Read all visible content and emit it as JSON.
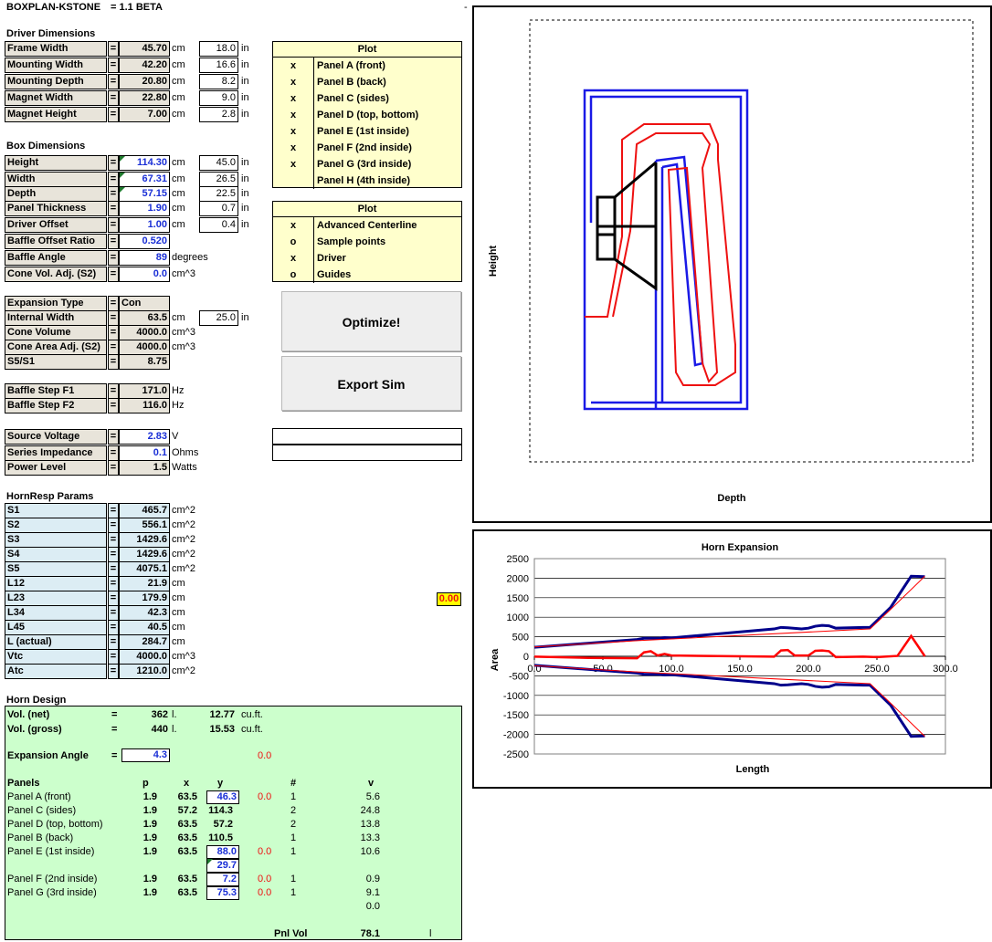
{
  "title": {
    "app": "BOXPLAN-KSTONE",
    "version": "= 1.1 BETA"
  },
  "corner_mark": "-",
  "driver": {
    "heading": "Driver Dimensions",
    "rows": [
      {
        "label": "Frame Width",
        "eq": "=",
        "value": "45.70",
        "unit": "cm",
        "inch": "18.0",
        "iunit": "in"
      },
      {
        "label": "Mounting Width",
        "eq": "=",
        "value": "42.20",
        "unit": "cm",
        "inch": "16.6",
        "iunit": "in"
      },
      {
        "label": "Mounting Depth",
        "eq": "=",
        "value": "20.80",
        "unit": "cm",
        "inch": "8.2",
        "iunit": "in"
      },
      {
        "label": "Magnet Width",
        "eq": "=",
        "value": "22.80",
        "unit": "cm",
        "inch": "9.0",
        "iunit": "in"
      },
      {
        "label": "Magnet Height",
        "eq": "=",
        "value": "7.00",
        "unit": "cm",
        "inch": "2.8",
        "iunit": "in"
      }
    ]
  },
  "box": {
    "heading": "Box Dimensions",
    "rows": [
      {
        "label": "Height",
        "eq": "=",
        "value": "114.30",
        "unit": "cm",
        "inch": "45.0",
        "iunit": "in"
      },
      {
        "label": "Width",
        "eq": "=",
        "value": "67.31",
        "unit": "cm",
        "inch": "26.5",
        "iunit": "in"
      },
      {
        "label": "Depth",
        "eq": "=",
        "value": "57.15",
        "unit": "cm",
        "inch": "22.5",
        "iunit": "in"
      },
      {
        "label": "Panel Thickness",
        "eq": "=",
        "value": "1.90",
        "unit": "cm",
        "inch": "0.7",
        "iunit": "in"
      },
      {
        "label": "Driver Offset",
        "eq": "=",
        "value": "1.00",
        "unit": "cm",
        "inch": "0.4",
        "iunit": "in"
      },
      {
        "label": "Baffle Offset Ratio",
        "eq": "=",
        "value": "0.520",
        "unit": ""
      },
      {
        "label": "Baffle Angle",
        "eq": "=",
        "value": "89",
        "unit": "degrees"
      },
      {
        "label": "Cone Vol. Adj. (S2)",
        "eq": "=",
        "value": "0.0",
        "unit": "cm^3"
      }
    ]
  },
  "expansion": {
    "rows": [
      {
        "label": "Expansion Type",
        "eq": "=",
        "value": "Con"
      },
      {
        "label": "Internal Width",
        "eq": "=",
        "value": "63.5",
        "unit": "cm",
        "inch": "25.0",
        "iunit": "in"
      },
      {
        "label": "Cone Volume",
        "eq": "=",
        "value": "4000.0",
        "unit": "cm^3"
      },
      {
        "label": "Cone Area Adj. (S2)",
        "eq": "=",
        "value": "4000.0",
        "unit": "cm^3"
      },
      {
        "label": "S5/S1",
        "eq": "=",
        "value": "8.75"
      }
    ]
  },
  "baffle_step": [
    {
      "label": "Baffle Step F1",
      "eq": "=",
      "value": "171.0",
      "unit": "Hz"
    },
    {
      "label": "Baffle Step F2",
      "eq": "=",
      "value": "116.0",
      "unit": "Hz"
    }
  ],
  "source": [
    {
      "label": "Source Voltage",
      "eq": "=",
      "value": "2.83",
      "unit": "V"
    },
    {
      "label": "Series Impedance",
      "eq": "=",
      "value": "0.1",
      "unit": "Ohms"
    },
    {
      "label": "Power Level",
      "eq": "=",
      "value": "1.5",
      "unit": "Watts"
    }
  ],
  "hornresp": {
    "heading": "HornResp Params",
    "rows": [
      {
        "label": "S1",
        "eq": "=",
        "value": "465.7",
        "unit": "cm^2"
      },
      {
        "label": "S2",
        "eq": "=",
        "value": "556.1",
        "unit": "cm^2"
      },
      {
        "label": "S3",
        "eq": "=",
        "value": "1429.6",
        "unit": "cm^2"
      },
      {
        "label": "S4",
        "eq": "=",
        "value": "1429.6",
        "unit": "cm^2"
      },
      {
        "label": "S5",
        "eq": "=",
        "value": "4075.1",
        "unit": "cm^2"
      },
      {
        "label": "L12",
        "eq": "=",
        "value": "21.9",
        "unit": "cm"
      },
      {
        "label": "L23",
        "eq": "=",
        "value": "179.9",
        "unit": "cm"
      },
      {
        "label": "L34",
        "eq": "=",
        "value": "42.3",
        "unit": "cm"
      },
      {
        "label": "L45",
        "eq": "=",
        "value": "40.5",
        "unit": "cm"
      },
      {
        "label": "L (actual)",
        "eq": "=",
        "value": "284.7",
        "unit": "cm"
      },
      {
        "label": "Vtc",
        "eq": "=",
        "value": "4000.0",
        "unit": "cm^3"
      },
      {
        "label": "Atc",
        "eq": "=",
        "value": "1210.0",
        "unit": "cm^2"
      }
    ]
  },
  "yellow_value": "0.00",
  "plot1": {
    "header": "Plot",
    "rows": [
      {
        "mark": "x",
        "label": "Panel A (front)"
      },
      {
        "mark": "x",
        "label": "Panel B (back)"
      },
      {
        "mark": "x",
        "label": "Panel C (sides)"
      },
      {
        "mark": "x",
        "label": "Panel D (top, bottom)"
      },
      {
        "mark": "x",
        "label": "Panel E (1st inside)"
      },
      {
        "mark": "x",
        "label": "Panel F (2nd inside)"
      },
      {
        "mark": "x",
        "label": "Panel G (3rd inside)"
      },
      {
        "mark": "",
        "label": "Panel H (4th inside)"
      }
    ]
  },
  "plot2": {
    "header": "Plot",
    "rows": [
      {
        "mark": "x",
        "label": "Advanced Centerline"
      },
      {
        "mark": "o",
        "label": "Sample points"
      },
      {
        "mark": "x",
        "label": "Driver"
      },
      {
        "mark": "o",
        "label": "Guides"
      }
    ]
  },
  "buttons": {
    "optimize": "Optimize!",
    "export": "Export Sim"
  },
  "horn_design": {
    "heading": "Horn Design",
    "vol_net": {
      "label": "Vol. (net)",
      "eq": "=",
      "value": "362",
      "unit": "l.",
      "ft": "12.77",
      "ftunit": "cu.ft."
    },
    "vol_gross": {
      "label": "Vol. (gross)",
      "eq": "=",
      "value": "440",
      "unit": "l.",
      "ft": "15.53",
      "ftunit": "cu.ft."
    },
    "expansion_angle": {
      "label": "Expansion Angle",
      "eq": "=",
      "value": "4.3",
      "delta": "0.0"
    },
    "columns": {
      "name": "Panels",
      "p": "p",
      "x": "x",
      "y": "y",
      "n": "#",
      "v": "v"
    },
    "panels": [
      {
        "name": "Panel A (front)",
        "p": "1.9",
        "x": "63.5",
        "y": "46.3",
        "boxed": true,
        "delta": "0.0",
        "n": "1",
        "v": "5.6"
      },
      {
        "name": "Panel C (sides)",
        "p": "1.9",
        "x": "57.2",
        "y": "114.3",
        "boxed": false,
        "delta": "",
        "n": "2",
        "v": "24.8"
      },
      {
        "name": "Panel D (top, bottom)",
        "p": "1.9",
        "x": "63.5",
        "y": "57.2",
        "boxed": false,
        "delta": "",
        "n": "2",
        "v": "13.8"
      },
      {
        "name": "Panel B (back)",
        "p": "1.9",
        "x": "63.5",
        "y": "110.5",
        "boxed": false,
        "delta": "",
        "n": "1",
        "v": "13.3"
      },
      {
        "name": "Panel E (1st inside)",
        "p": "1.9",
        "x": "63.5",
        "y": "88.0",
        "boxed": true,
        "delta": "0.0",
        "n": "1",
        "v": "10.6"
      },
      {
        "name": "",
        "p": "",
        "x": "",
        "y": "29.7",
        "boxed": true,
        "delta": "",
        "n": "",
        "v": ""
      },
      {
        "name": "Panel F (2nd inside)",
        "p": "1.9",
        "x": "63.5",
        "y": "7.2",
        "boxed": true,
        "delta": "0.0",
        "n": "1",
        "v": "0.9"
      },
      {
        "name": "Panel G (3rd inside)",
        "p": "1.9",
        "x": "63.5",
        "y": "75.3",
        "boxed": true,
        "delta": "0.0",
        "n": "1",
        "v": "9.1"
      },
      {
        "name": "",
        "p": "",
        "x": "",
        "y": "",
        "boxed": false,
        "delta": "",
        "n": "",
        "v": "0.0"
      }
    ],
    "pnl_vol": {
      "label": "Pnl Vol",
      "value": "78.1",
      "unit": "l"
    }
  },
  "layout_chart": {
    "xlabel": "Depth",
    "ylabel": "Height"
  },
  "chart_data": {
    "type": "line",
    "title": "Horn Expansion",
    "xlabel": "Length",
    "ylabel": "Area",
    "xlim": [
      0,
      300
    ],
    "ylim": [
      -2500,
      2500
    ],
    "xticks": [
      "0.0",
      "50.0",
      "100.0",
      "150.0",
      "200.0",
      "250.0",
      "300.0"
    ],
    "yticks": [
      "2500",
      "2000",
      "1500",
      "1000",
      "500",
      "0",
      "-500",
      "-1000",
      "-1500",
      "-2000",
      "-2500"
    ],
    "grid": true,
    "series": [
      {
        "name": "",
        "color": "#00008b",
        "x": [
          0,
          75,
          80,
          90,
          95,
          100,
          175,
          180,
          185,
          195,
          200,
          205,
          210,
          215,
          220,
          240,
          245,
          260,
          275,
          285
        ],
        "y": [
          230,
          430,
          460,
          460,
          480,
          470,
          700,
          740,
          730,
          700,
          720,
          770,
          790,
          780,
          720,
          740,
          740,
          1250,
          2050,
          2040
        ]
      },
      {
        "name": "",
        "color": "#00008b",
        "x": [
          0,
          75,
          80,
          90,
          95,
          100,
          175,
          180,
          185,
          195,
          200,
          205,
          210,
          215,
          220,
          240,
          245,
          260,
          275,
          285
        ],
        "y": [
          -230,
          -430,
          -460,
          -460,
          -480,
          -470,
          -700,
          -740,
          -730,
          -700,
          -720,
          -770,
          -790,
          -780,
          -720,
          -740,
          -740,
          -1250,
          -2050,
          -2040
        ]
      },
      {
        "name": "",
        "color": "#ff0000",
        "x": [
          0,
          40,
          75,
          80,
          85,
          90,
          95,
          100,
          175,
          180,
          185,
          190,
          200,
          205,
          210,
          215,
          220,
          240,
          250,
          265,
          275,
          285
        ],
        "y": [
          -10,
          -40,
          -50,
          100,
          130,
          20,
          60,
          20,
          -10,
          150,
          160,
          20,
          20,
          140,
          150,
          130,
          -20,
          -10,
          -20,
          10,
          520,
          0
        ]
      },
      {
        "name": "",
        "color": "#ff0000",
        "x": [
          0,
          75,
          245,
          260,
          285
        ],
        "y": [
          240,
          400,
          700,
          1200,
          2050
        ]
      },
      {
        "name": "",
        "color": "#ff0000",
        "x": [
          0,
          75,
          245,
          260,
          285
        ],
        "y": [
          -240,
          -400,
          -700,
          -1200,
          -2050
        ]
      }
    ]
  }
}
